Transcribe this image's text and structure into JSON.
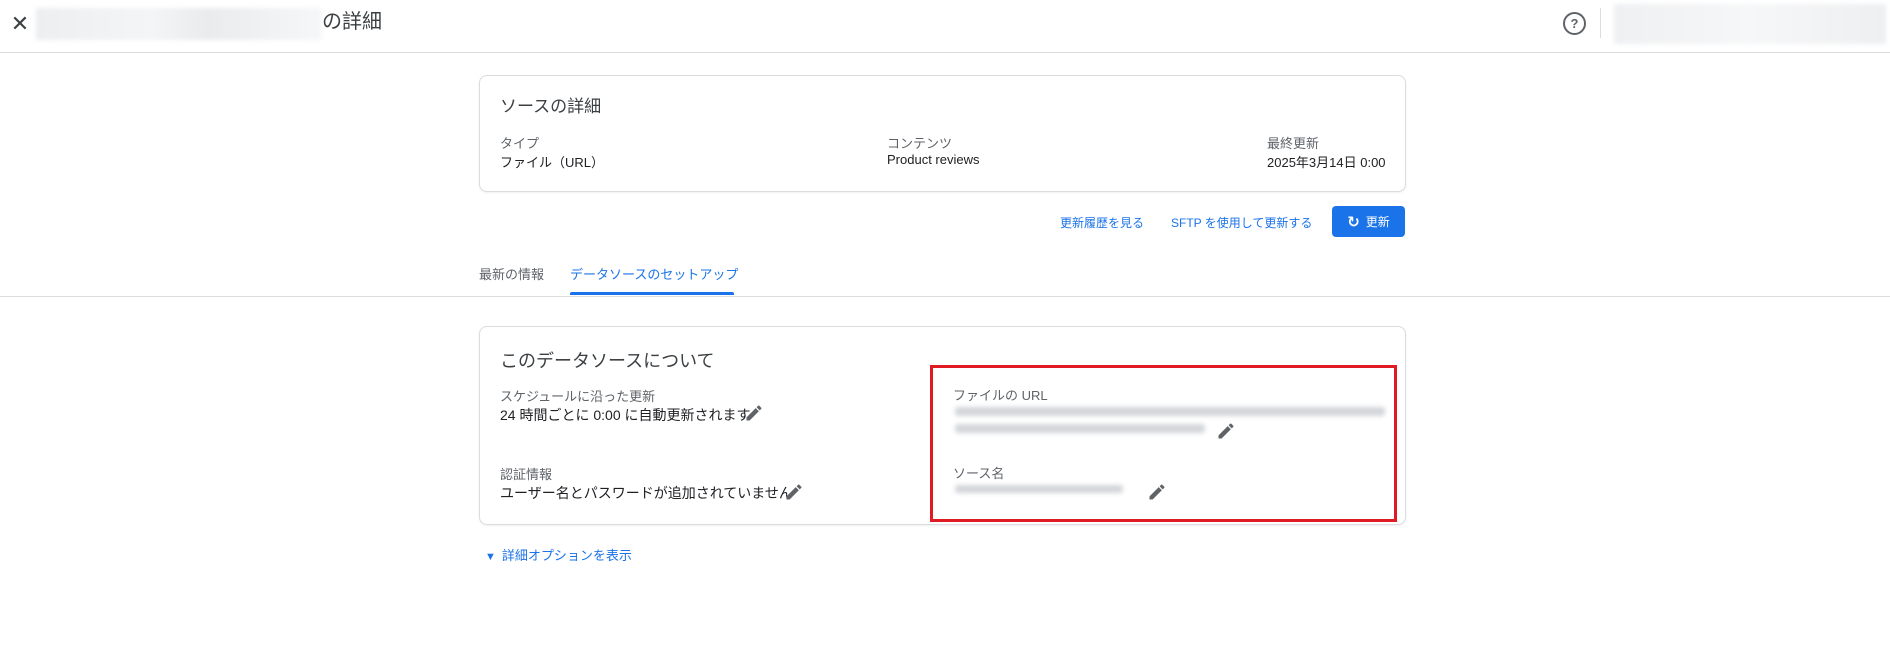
{
  "header": {
    "close_icon": "close-icon",
    "title_suffix": "の詳細",
    "help_icon": "help-circle-icon"
  },
  "summary_card": {
    "title": "ソースの詳細",
    "type_label": "タイプ",
    "type_value": "ファイル（URL）",
    "content_label": "コンテンツ",
    "content_value": "Product reviews",
    "updated_label": "最終更新",
    "updated_value": "2025年3月14日 0:00"
  },
  "actions": {
    "history_link": "更新履歴を見る",
    "sftp_link": "SFTP を使用して更新する",
    "refresh_button": "更新",
    "refresh_icon": "refresh-icon"
  },
  "tabs": [
    {
      "label": "最新の情報",
      "active": false
    },
    {
      "label": "データソースのセットアップ",
      "active": true
    }
  ],
  "setup_card": {
    "title": "このデータソースについて",
    "schedule_label": "スケジュールに沿った更新",
    "schedule_value": "24 時間ごとに 0:00 に自動更新されます",
    "auth_label": "認証情報",
    "auth_value": "ユーザー名とパスワードが追加されていません",
    "file_url_label": "ファイルの URL",
    "source_name_label": "ソース名",
    "edit_icon": "pencil-icon"
  },
  "expander": {
    "label": "詳細オプションを表示",
    "icon": "chevron-down-icon"
  },
  "colors": {
    "accent": "#1a73e8",
    "highlight": "#e01b24"
  }
}
